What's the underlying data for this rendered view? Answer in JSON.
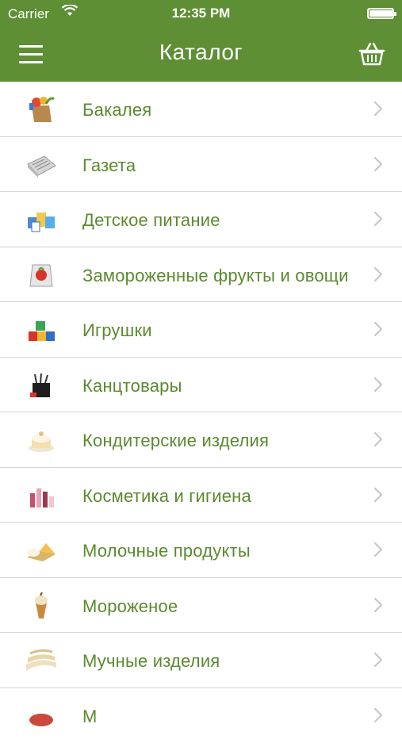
{
  "status_bar": {
    "carrier": "Carrier",
    "time": "12:35 PM"
  },
  "nav": {
    "title": "Каталог",
    "menu_icon": "hamburger-menu-icon",
    "cart_icon": "basket-icon"
  },
  "colors": {
    "bar": "#5e8f35",
    "label": "#5a8a2f",
    "chevron": "#c7c7cc"
  },
  "catalog": {
    "items": [
      {
        "label": "Бакалея",
        "icon": "groceries-bag-icon"
      },
      {
        "label": "Газета",
        "icon": "newspaper-icon"
      },
      {
        "label": "Детское питание",
        "icon": "baby-food-icon"
      },
      {
        "label": "Замороженные фрукты и овощи",
        "icon": "frozen-fruit-icon"
      },
      {
        "label": "Игрушки",
        "icon": "toy-blocks-icon"
      },
      {
        "label": "Канцтовары",
        "icon": "stationery-icon"
      },
      {
        "label": "Кондитерские изделия",
        "icon": "cake-icon"
      },
      {
        "label": "Косметика и гигиена",
        "icon": "cosmetics-icon"
      },
      {
        "label": "Молочные продукты",
        "icon": "dairy-icon"
      },
      {
        "label": "Мороженое",
        "icon": "ice-cream-icon"
      },
      {
        "label": "Мучные изделия",
        "icon": "flour-products-icon"
      },
      {
        "label": "М",
        "icon": "meat-icon"
      }
    ]
  }
}
